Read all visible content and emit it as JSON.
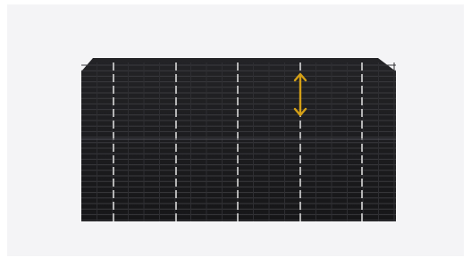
{
  "image": {
    "background_color": "#f4f4f6",
    "panel_color": "#1b1b1d",
    "grid_line_color": "#3a3a3e",
    "busbar_color": "#d8d8d8",
    "arrow_color": "#d4a017",
    "arrow_icon": "vertical-double-arrow-icon"
  }
}
